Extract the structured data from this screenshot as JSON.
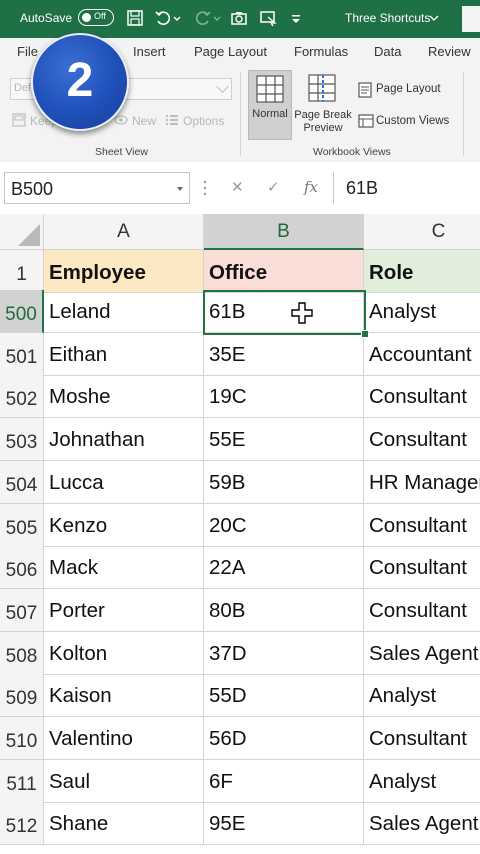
{
  "titlebar": {
    "autosave_label": "AutoSave",
    "autosave_state": "Off",
    "document_title": "Three Shortcuts",
    "icons": [
      "save-icon",
      "undo-icon",
      "redo-icon",
      "camera-icon",
      "form-icon",
      "customize-icon"
    ]
  },
  "tabs": [
    "File",
    "Insert",
    "Page Layout",
    "Formulas",
    "Data",
    "Review"
  ],
  "ribbon": {
    "sheet_view": {
      "combo_value": "Def",
      "keep_label": "Keep",
      "new_label": "New",
      "options_label": "Options",
      "group_label": "Sheet View"
    },
    "workbook_views": {
      "normal_label": "Normal",
      "page_break_line1": "Page Break",
      "page_break_line2": "Preview",
      "page_layout_label": "Page Layout",
      "custom_views_label": "Custom Views",
      "group_label": "Workbook Views"
    },
    "step_badge": "2"
  },
  "formula_bar": {
    "name_box": "B500",
    "fx_label": "fx",
    "value": "61B"
  },
  "columns": [
    {
      "letter": "A",
      "selected": false
    },
    {
      "letter": "B",
      "selected": true
    },
    {
      "letter": "C",
      "selected": false
    }
  ],
  "header_row": {
    "number": "1",
    "cells": [
      "Employee",
      "Office",
      "Role"
    ],
    "colors": [
      "#fde8c4",
      "#f9ddd6",
      "#e2eedc"
    ]
  },
  "rows": [
    {
      "number": "500",
      "cells": [
        "Leland",
        "61B",
        "Analyst"
      ],
      "selected": true
    },
    {
      "number": "501",
      "cells": [
        "Eithan",
        "35E",
        "Accountant"
      ]
    },
    {
      "number": "502",
      "cells": [
        "Moshe",
        "19C",
        "Consultant"
      ]
    },
    {
      "number": "503",
      "cells": [
        "Johnathan",
        "55E",
        "Consultant"
      ]
    },
    {
      "number": "504",
      "cells": [
        "Lucca",
        "59B",
        "HR Manager"
      ]
    },
    {
      "number": "505",
      "cells": [
        "Kenzo",
        "20C",
        "Consultant"
      ]
    },
    {
      "number": "506",
      "cells": [
        "Mack",
        "22A",
        "Consultant"
      ]
    },
    {
      "number": "507",
      "cells": [
        "Porter",
        "80B",
        "Consultant"
      ]
    },
    {
      "number": "508",
      "cells": [
        "Kolton",
        "37D",
        "Sales Agent"
      ]
    },
    {
      "number": "509",
      "cells": [
        "Kaison",
        "55D",
        "Analyst"
      ]
    },
    {
      "number": "510",
      "cells": [
        "Valentino",
        "56D",
        "Consultant"
      ]
    },
    {
      "number": "511",
      "cells": [
        "Saul",
        "6F",
        "Analyst"
      ]
    },
    {
      "number": "512",
      "cells": [
        "Shane",
        "95E",
        "Sales Agent"
      ]
    }
  ],
  "theme": {
    "accent": "#217346",
    "titlebar": "#1e7145"
  }
}
